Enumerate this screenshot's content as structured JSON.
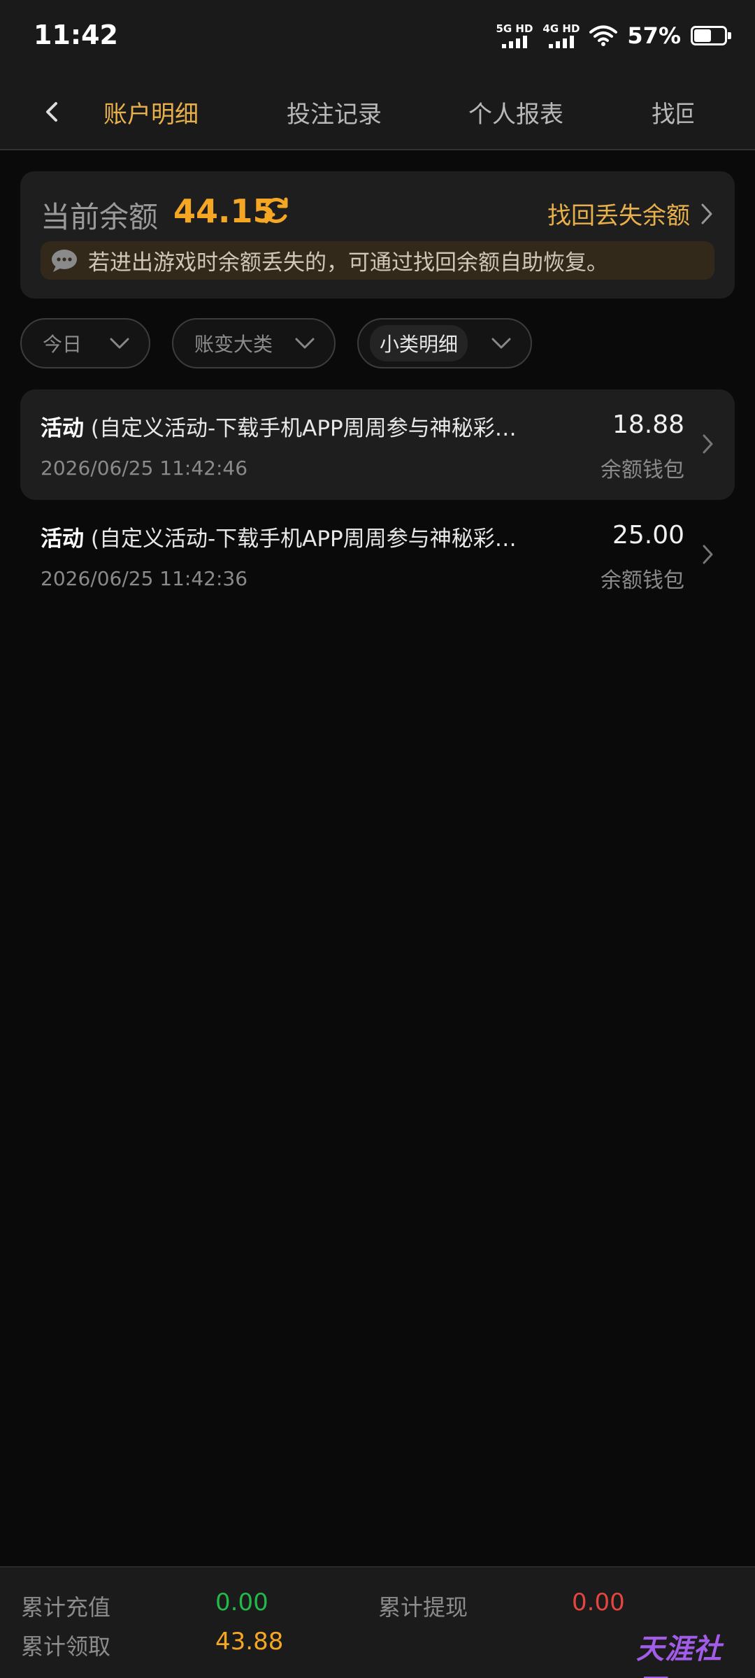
{
  "status_bar": {
    "time": "11:42",
    "net1": "5G HD",
    "net2": "4G HD",
    "battery_pct": "57%",
    "battery_level": 0.57
  },
  "nav": {
    "tabs": [
      {
        "label": "账户明细",
        "active": true
      },
      {
        "label": "投注记录",
        "active": false
      },
      {
        "label": "个人报表",
        "active": false
      },
      {
        "label": "找回",
        "active": false
      }
    ]
  },
  "balance": {
    "label": "当前余额",
    "value": "44.15",
    "recover_label": "找回丢失余额",
    "notice": "若进出游戏时余额丢失的，可通过找回余额自助恢复。"
  },
  "filters": {
    "date": "今日",
    "category": "账变大类",
    "subcategory": "小类明细"
  },
  "records": [
    {
      "type": "活动",
      "desc": "(自定义活动-下载手机APP周周参与神秘彩…",
      "time": "2026/06/25 11:42:46",
      "amount": "18.88",
      "wallet": "余额钱包"
    },
    {
      "type": "活动",
      "desc": "(自定义活动-下载手机APP周周参与神秘彩…",
      "time": "2026/06/25 11:42:36",
      "amount": "25.00",
      "wallet": "余额钱包"
    }
  ],
  "summary": {
    "recharge_label": "累计充值",
    "recharge_value": "0.00",
    "withdraw_label": "累计提现",
    "withdraw_value": "0.00",
    "claim_label": "累计领取",
    "claim_value": "43.88"
  },
  "watermark": {
    "text": "天涯社区"
  },
  "colors": {
    "accent": "#e8b04a",
    "balance": "#f5a623",
    "green": "#22b84a",
    "red": "#e2463f"
  }
}
